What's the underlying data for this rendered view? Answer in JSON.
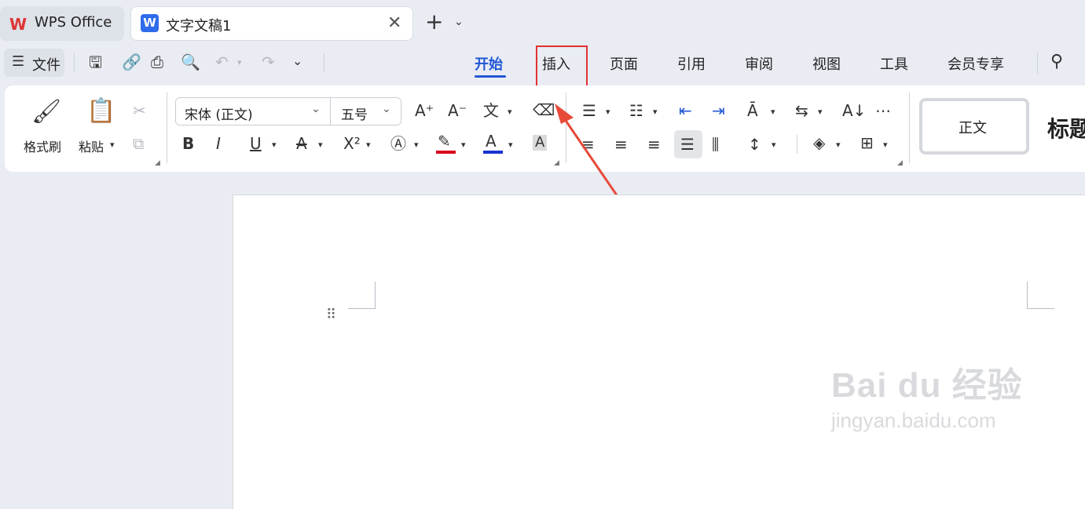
{
  "tabs": {
    "app_label": "WPS Office",
    "doc_label": "文字文稿1",
    "doc_icon_letter": "W"
  },
  "toolbar": {
    "file_label": "文件"
  },
  "ribbon_tabs": [
    "开始",
    "插入",
    "页面",
    "引用",
    "审阅",
    "视图",
    "工具",
    "会员专享"
  ],
  "clipboard": {
    "format_painter": "格式刷",
    "paste": "粘贴"
  },
  "font": {
    "family": "宋体 (正文)",
    "size": "五号"
  },
  "styles": {
    "normal": "正文",
    "heading": "标题"
  },
  "watermark": {
    "logo": "Bai du 经验",
    "url": "jingyan.baidu.com"
  },
  "colors": {
    "accent": "#2257d6",
    "highlight_box": "#e03434",
    "highlight_color": "#d9001b",
    "font_color": "#1a33d1"
  }
}
